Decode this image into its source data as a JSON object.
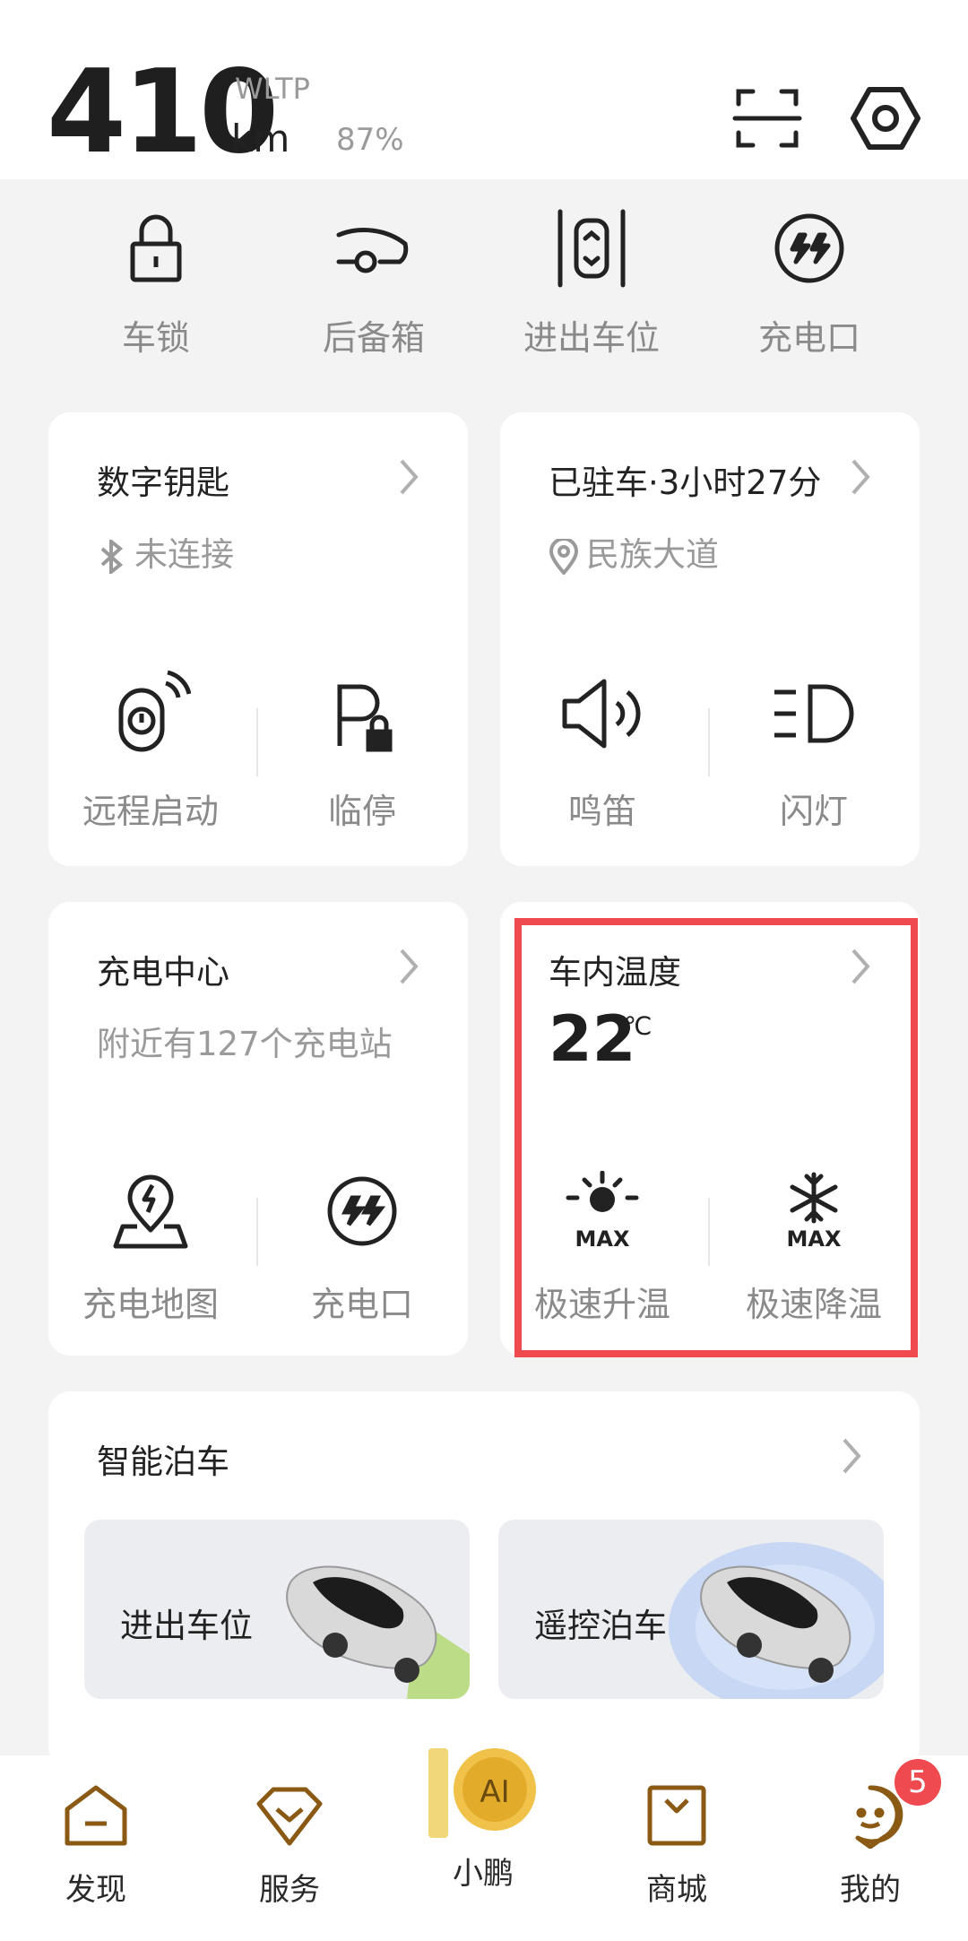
{
  "header": {
    "range_value": "410",
    "range_unit": "km",
    "standard": "WLTP",
    "battery_percent": "87%"
  },
  "quick_actions": [
    {
      "label": "车锁",
      "icon": "lock-icon"
    },
    {
      "label": "后备箱",
      "icon": "trunk-icon"
    },
    {
      "label": "进出车位",
      "icon": "parking-exit-icon"
    },
    {
      "label": "充电口",
      "icon": "charge-port-icon"
    }
  ],
  "digital_key": {
    "title": "数字钥匙",
    "status": "未连接",
    "actions": [
      "远程启动",
      "临停"
    ]
  },
  "parked": {
    "title": "已驻车·3小时27分",
    "location": "民族大道",
    "actions": [
      "鸣笛",
      "闪灯"
    ]
  },
  "charging_center": {
    "title": "充电中心",
    "subtitle": "附近有127个充电站",
    "actions": [
      "充电地图",
      "充电口"
    ]
  },
  "cabin_temp": {
    "title": "车内温度",
    "value": "22",
    "unit": "℃",
    "max_label": "MAX",
    "actions": [
      "极速升温",
      "极速降温"
    ]
  },
  "smart_parking": {
    "title": "智能泊车",
    "tiles": [
      "进出车位",
      "遥控泊车"
    ]
  },
  "tabbar": {
    "tabs": [
      {
        "label": "发现",
        "icon": "discover-icon"
      },
      {
        "label": "服务",
        "icon": "service-icon"
      },
      {
        "label": "小鹏",
        "icon": "ai-logo-icon"
      },
      {
        "label": "商城",
        "icon": "mall-icon"
      },
      {
        "label": "我的",
        "icon": "profile-icon"
      }
    ],
    "badge_count": "5",
    "ai_text": "AI"
  },
  "colors": {
    "accent_gold": "#8a5a14",
    "highlight_red": "#ef4a4f",
    "card_bg": "#ffffff",
    "page_bg": "#f3f3f3"
  }
}
